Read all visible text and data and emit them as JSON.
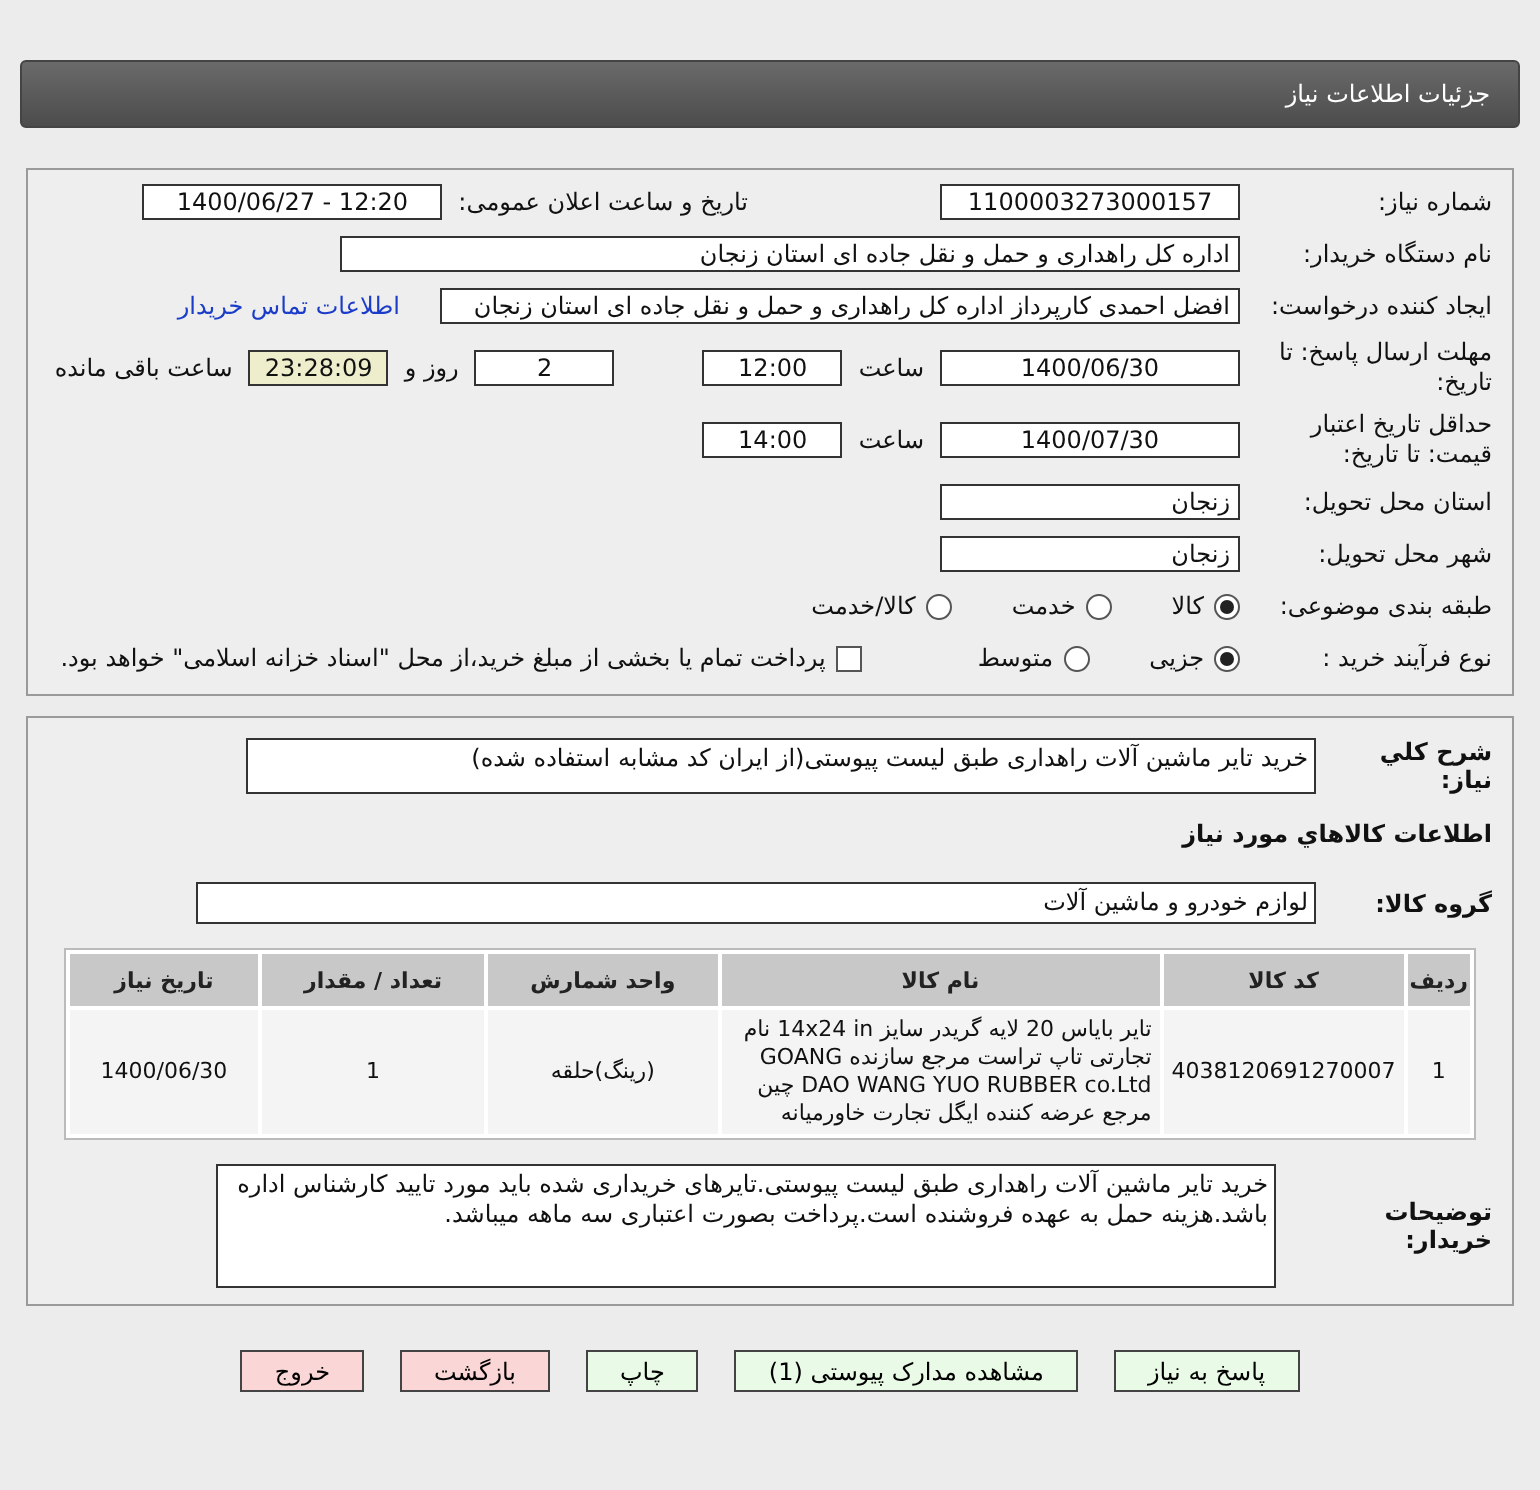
{
  "header": {
    "title": "جزئیات اطلاعات نیاز"
  },
  "details": {
    "need_number": {
      "label": "شماره نیاز:",
      "value": "1100003273000157"
    },
    "announce": {
      "label": "تاریخ و ساعت اعلان عمومی:",
      "value": "1400/06/27 - 12:20"
    },
    "buyer_org": {
      "label": "نام دستگاه خریدار:",
      "value": "اداره کل راهداری و حمل و نقل جاده ای استان زنجان"
    },
    "requester": {
      "label": "ایجاد کننده درخواست:",
      "value": "افضل احمدی کارپرداز اداره کل راهداری و حمل و نقل جاده ای استان زنجان",
      "link": "اطلاعات تماس خریدار"
    },
    "reply_deadline": {
      "label": "مهلت ارسال پاسخ: تا تاریخ:",
      "date": "1400/06/30",
      "time_label": "ساعت",
      "time": "12:00",
      "days": "2",
      "days_label": "روز و",
      "remaining": "23:28:09",
      "remaining_label": "ساعت باقی مانده"
    },
    "price_validity": {
      "label": "حداقل تاریخ اعتبار قیمت: تا تاریخ:",
      "date": "1400/07/30",
      "time_label": "ساعت",
      "time": "14:00"
    },
    "province": {
      "label": "استان محل تحویل:",
      "value": "زنجان"
    },
    "city": {
      "label": "شهر محل تحویل:",
      "value": "زنجان"
    },
    "category": {
      "label": "طبقه بندی موضوعی:",
      "options": [
        {
          "label": "کالا",
          "selected": true
        },
        {
          "label": "خدمت",
          "selected": false
        },
        {
          "label": "کالا/خدمت",
          "selected": false
        }
      ]
    },
    "process": {
      "label": "نوع فرآیند خرید :",
      "options": [
        {
          "label": "جزیی",
          "selected": true
        },
        {
          "label": "متوسط",
          "selected": false
        }
      ],
      "checkbox": {
        "label": "پرداخت تمام یا بخشی از مبلغ خرید،از محل \"اسناد خزانه اسلامی\" خواهد بود.",
        "checked": false
      }
    }
  },
  "goods": {
    "summary": {
      "label": "شرح کلي نياز:",
      "value": "خرید تایر ماشین آلات راهداری طبق لیست پیوستی(از ایران کد مشابه استفاده شده)"
    },
    "items_title": "اطلاعات کالاهاي مورد نياز",
    "group": {
      "label": "گروه کالا:",
      "value": "لوازم خودرو و ماشین آلات"
    },
    "table": {
      "columns": [
        "ردیف",
        "کد کالا",
        "نام کالا",
        "واحد شمارش",
        "تعداد / مقدار",
        "تاریخ نیاز"
      ],
      "rows": [
        [
          "1",
          "4038120691270007",
          "تایر بایاس 20 لایه گریدر سایز 14x24 in نام تجارتی تاپ تراست مرجع سازنده GOANG DAO WANG YUO RUBBER co.Ltd چین مرجع عرضه کننده ایگل تجارت خاورمیانه",
          "(رینگ)حلقه",
          "1",
          "1400/06/30"
        ]
      ]
    },
    "notes": {
      "label": "توضیحات خریدار:",
      "value": "خرید تایر ماشین آلات راهداری طبق لیست پیوستی.تایرهای خریداری شده باید مورد تایید کارشناس اداره باشد.هزینه حمل به عهده فروشنده است.پرداخت بصورت اعتباری سه ماهه میباشد."
    }
  },
  "buttons": [
    {
      "label": "پاسخ به نیاز",
      "kind": "green"
    },
    {
      "label": "مشاهده مدارک پیوستی (1)",
      "kind": "green"
    },
    {
      "label": "چاپ",
      "kind": "green"
    },
    {
      "label": "بازگشت",
      "kind": "red"
    },
    {
      "label": "خروج",
      "kind": "red"
    }
  ]
}
